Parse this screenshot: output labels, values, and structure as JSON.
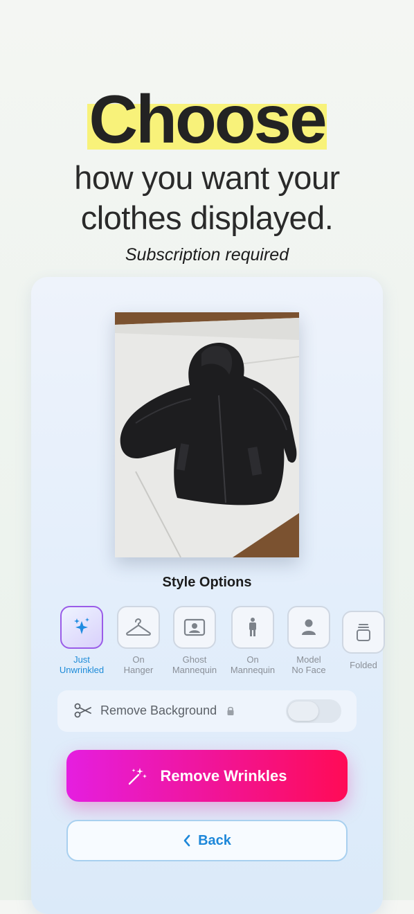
{
  "hero": {
    "headline": "Choose",
    "line1": "how you want your",
    "line2": "clothes displayed.",
    "note": "Subscription required"
  },
  "photo": {
    "subject": "black hooded jacket on white table"
  },
  "style_options": {
    "title": "Style Options",
    "items": [
      {
        "line1": "Just",
        "line2": "Unwrinkled",
        "icon": "sparkles-icon",
        "selected": true
      },
      {
        "line1": "On",
        "line2": "Hanger",
        "icon": "hanger-icon",
        "selected": false
      },
      {
        "line1": "Ghost",
        "line2": "Mannequin",
        "icon": "portrait-frame-icon",
        "selected": false
      },
      {
        "line1": "On",
        "line2": "Mannequin",
        "icon": "mannequin-icon",
        "selected": false
      },
      {
        "line1": "Model",
        "line2": "No Face",
        "icon": "person-icon",
        "selected": false
      },
      {
        "line1": "Folded",
        "line2": "",
        "icon": "folded-stack-icon",
        "selected": false
      }
    ]
  },
  "remove_background": {
    "label": "Remove Background",
    "locked": true,
    "enabled": false
  },
  "actions": {
    "primary": "Remove Wrinkles",
    "back": "Back"
  },
  "colors": {
    "highlight": "#f8f27a",
    "accent_blue": "#1d87d9",
    "gradient_start": "#e51ee0",
    "gradient_end": "#ff0b56"
  }
}
